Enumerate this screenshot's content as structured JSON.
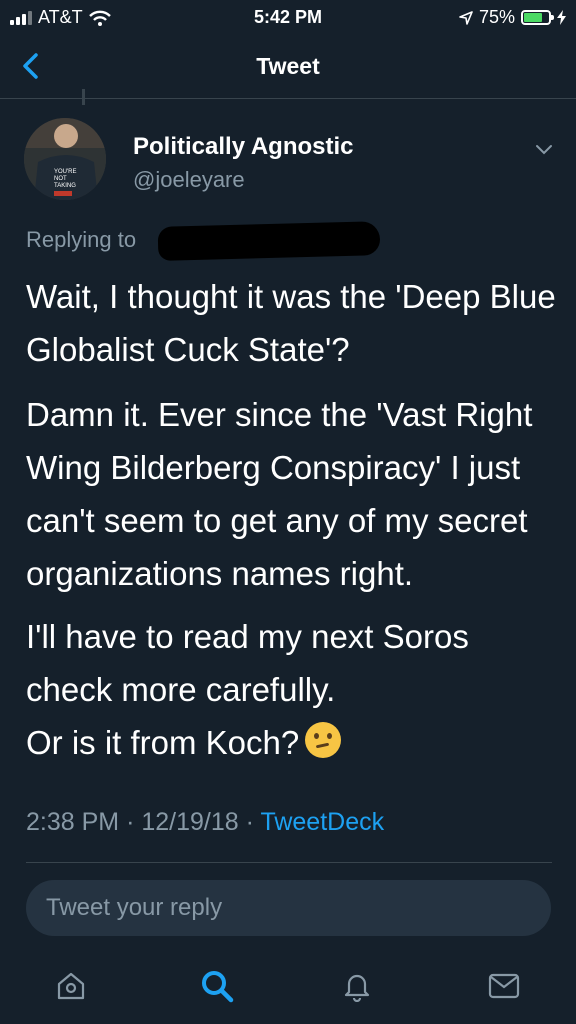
{
  "status_bar": {
    "carrier": "AT&T",
    "time": "5:42 PM",
    "battery": "75%",
    "battery_level": 0.75
  },
  "nav": {
    "title": "Tweet"
  },
  "tweet": {
    "display_name": "Politically Agnostic",
    "handle": "@joeleyare",
    "replying_label": "Replying to",
    "paragraphs": [
      "Wait, I thought it was the 'Deep Blue Globalist Cuck State'?",
      "Damn it. Ever since the 'Vast Right Wing Bilderberg Conspiracy' I just can't seem to get any of my secret organizations names right.",
      "I'll have to read my next Soros check more carefully."
    ],
    "last_line": "Or is it from Koch?",
    "time": "2:38 PM",
    "sep1": "·",
    "date": "12/19/18",
    "sep2": "·",
    "source": "TweetDeck"
  },
  "reply_box": {
    "placeholder": "Tweet your reply"
  },
  "colors": {
    "background": "#15202b",
    "accent": "#1da1f2",
    "muted": "#8899a6"
  },
  "tabs": [
    "home-icon",
    "search-icon",
    "notifications-icon",
    "messages-icon"
  ]
}
